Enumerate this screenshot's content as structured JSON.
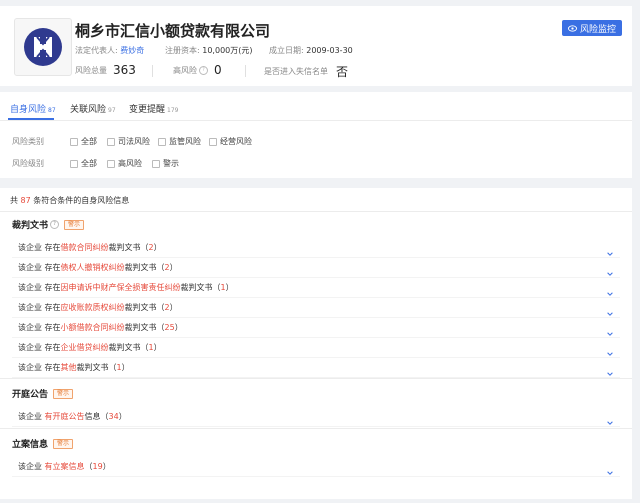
{
  "company": {
    "name": "桐乡市汇信小额贷款有限公司",
    "legal_rep_label": "法定代表人:",
    "legal_rep": "费妙奇",
    "capital_label": "注册资本:",
    "capital": "10,000万(元)",
    "founded_label": "成立日期:",
    "founded": "2009-03-30",
    "risk_total_label": "风险总量",
    "risk_total": "363",
    "high_risk_label": "高风险",
    "high_risk": "0",
    "blacklist_label": "是否进入失信名单",
    "blacklist": "否"
  },
  "monitor_button": {
    "label": "风险监控",
    "icon": "eye-icon"
  },
  "tabs": [
    {
      "label": "自身风险",
      "count": "87",
      "active": true
    },
    {
      "label": "关联风险",
      "count": "97",
      "active": false
    },
    {
      "label": "变更提醒",
      "count": "179",
      "active": false
    }
  ],
  "filters": {
    "type_label": "风险类别",
    "type_options": [
      "全部",
      "司法风险",
      "监管风险",
      "经营风险"
    ],
    "level_label": "风险级别",
    "level_options": [
      "全部",
      "高风险",
      "警示"
    ]
  },
  "summary": {
    "prefix": "共",
    "count": "87",
    "suffix": "条符合条件的自身风险信息"
  },
  "sections": [
    {
      "title": "裁判文书",
      "badge": "警示",
      "rows": [
        {
          "pre": "该企业 存在",
          "red": "借款合同纠纷",
          "post": "裁判文书（",
          "count": "2",
          "end": "）"
        },
        {
          "pre": "该企业 存在",
          "red": "债权人撤销权纠纷",
          "post": "裁判文书（",
          "count": "2",
          "end": "）"
        },
        {
          "pre": "该企业 存在",
          "red": "因申请诉中财产保全损害责任纠纷",
          "post": "裁判文书（",
          "count": "1",
          "end": "）"
        },
        {
          "pre": "该企业 存在",
          "red": "应收账款质权纠纷",
          "post": "裁判文书（",
          "count": "2",
          "end": "）"
        },
        {
          "pre": "该企业 存在",
          "red": "小额借款合同纠纷",
          "post": "裁判文书（",
          "count": "25",
          "end": "）"
        },
        {
          "pre": "该企业 存在",
          "red": "企业借贷纠纷",
          "post": "裁判文书（",
          "count": "1",
          "end": "）"
        },
        {
          "pre": "该企业 存在",
          "red": "其他",
          "post": "裁判文书（",
          "count": "1",
          "end": "）"
        }
      ]
    },
    {
      "title": "开庭公告",
      "badge": "警示",
      "rows": [
        {
          "pre": "该企业 ",
          "red": "有开庭公告",
          "post": "信息（",
          "count": "34",
          "end": "）"
        }
      ]
    },
    {
      "title": "立案信息",
      "badge": "警示",
      "rows": [
        {
          "pre": "该企业 ",
          "red": "有立案信息",
          "post": "（",
          "count": "19",
          "end": "）"
        }
      ]
    }
  ],
  "colors": {
    "accent": "#3a6fe3",
    "danger": "#e64a3b",
    "badge": "#e6782f"
  }
}
